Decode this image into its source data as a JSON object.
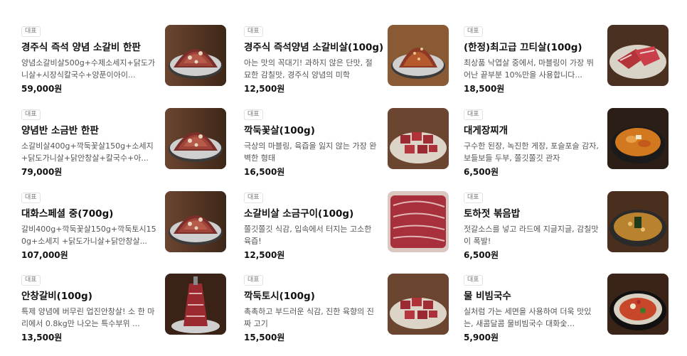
{
  "badge_label": "대표",
  "items": [
    {
      "name": "경주식 즉석 양념 소갈비 한판",
      "desc": "양념소갈비살500g+수제소세지+닭도가니살+시장식칼국수+양푼이아이...",
      "price": "59,000원"
    },
    {
      "name": "경주식 즉석양념 소갈비살(100g)",
      "desc": "아는 맛의 꼭대기! 과하지 않은 단맛, 절묘한 감칠맛, 경주식 양념의 미학",
      "price": "12,500원"
    },
    {
      "name": "(한정)최고급 끄티살(100g)",
      "desc": "최상품 낙엽살 중에서, 마블링이 가장 뛰어난 끝부분 10%만을 사용합니다...",
      "price": "18,500원"
    },
    {
      "name": "양념반 소금반 한판",
      "desc": "소갈비살400g+깍둑꽃살150g+소세지+닭도가니살+닭안창살+칼국수+아...",
      "price": "79,000원"
    },
    {
      "name": "깍둑꽃살(100g)",
      "desc": "극상의 마블링, 육즙을 잃지 않는 가장 완벽한 형태",
      "price": "16,500원"
    },
    {
      "name": "대게장찌개",
      "desc": "구수한 된장, 녹진한 게장, 포슬포슬 감자, 보들보들 두부, 쫄깃쫄깃 관자",
      "price": "6,500원"
    },
    {
      "name": "대화스페셜 중(700g)",
      "desc": "갈비400g+깍둑꽃살150g+깍둑토시150g+소세지 +닭도가니살+닭안창살...",
      "price": "107,000원"
    },
    {
      "name": "소갈비살 소금구이(100g)",
      "desc": "쫄깃쫄깃 식감, 입속에서 터지는 고소한 육즙!",
      "price": "12,500원"
    },
    {
      "name": "토하젓 볶음밥",
      "desc": "젓갈소스를 넣고 라드에 지글지글, 감칠맛이 폭발!",
      "price": "6,500원"
    },
    {
      "name": "안창갈비(100g)",
      "desc": "특제 양념에 버무린 업진안창살! 소 한 마리에서 0.8kg만 나오는 특수부위 ...",
      "price": "13,500원"
    },
    {
      "name": "깍둑토시(100g)",
      "desc": "촉촉하고 부드러운 식감, 진한 육향의 진짜 고기",
      "price": "15,500원"
    },
    {
      "name": "물 비빔국수",
      "desc": "실처럼 가는 세면을 사용하여 더욱 맛있는, 새콤달콤 물비빔국수 대화숯...",
      "price": "5,900원"
    }
  ],
  "thumbs": [
    "grilled-short-rib-platter-photo",
    "marinated-rib-mound-photo",
    "raw-premium-beef-photo",
    "half-and-half-platter-photo",
    "cubed-beef-photo",
    "crab-stew-photo",
    "special-platter-photo",
    "salted-rib-meat-photo",
    "fried-rice-photo",
    "rib-tower-photo",
    "cubed-skirt-photo",
    "cold-noodle-photo"
  ]
}
